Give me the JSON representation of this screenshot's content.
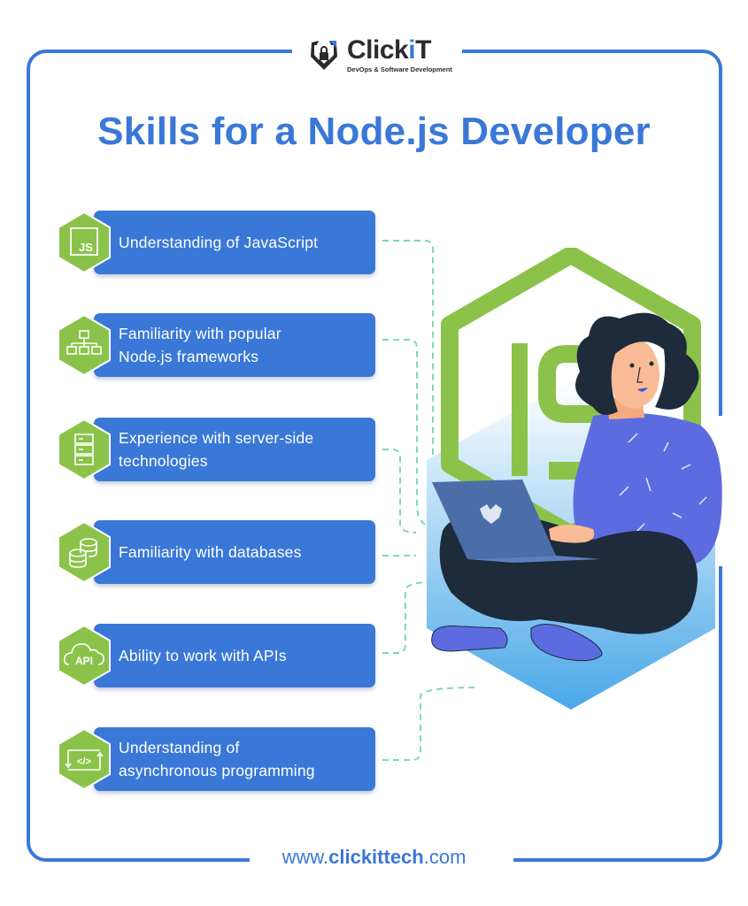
{
  "brand": {
    "name_prefix": "Click",
    "name_k": "i",
    "name_suffix": "T",
    "tagline": "DevOps & Software Development",
    "primary_color": "#3a78d8",
    "accent_green": "#8bc34a"
  },
  "title": "Skills for a Node.js Developer",
  "skills": [
    {
      "icon": "js-icon",
      "line1": "Understanding of JavaScript",
      "line2": ""
    },
    {
      "icon": "sitemap-icon",
      "line1": "Familiarity with popular",
      "line2": "Node.js frameworks"
    },
    {
      "icon": "server-icon",
      "line1": "Experience with server-side",
      "line2": "technologies"
    },
    {
      "icon": "database-icon",
      "line1": "Familiarity with databases",
      "line2": ""
    },
    {
      "icon": "cloud-api-icon",
      "line1": "Ability to work with APIs",
      "line2": ""
    },
    {
      "icon": "code-sync-icon",
      "line1": "Understanding of",
      "line2": "asynchronous programming"
    }
  ],
  "icon_labels": {
    "js": "JS",
    "api": "API",
    "code": "</>"
  },
  "illustration": {
    "logo_text": "JS",
    "description": "Woman with laptop sitting in front of Node.js hexagon logo"
  },
  "footer": {
    "url_prefix": "www.",
    "url_bold": "clickittech",
    "url_suffix": ".com"
  }
}
